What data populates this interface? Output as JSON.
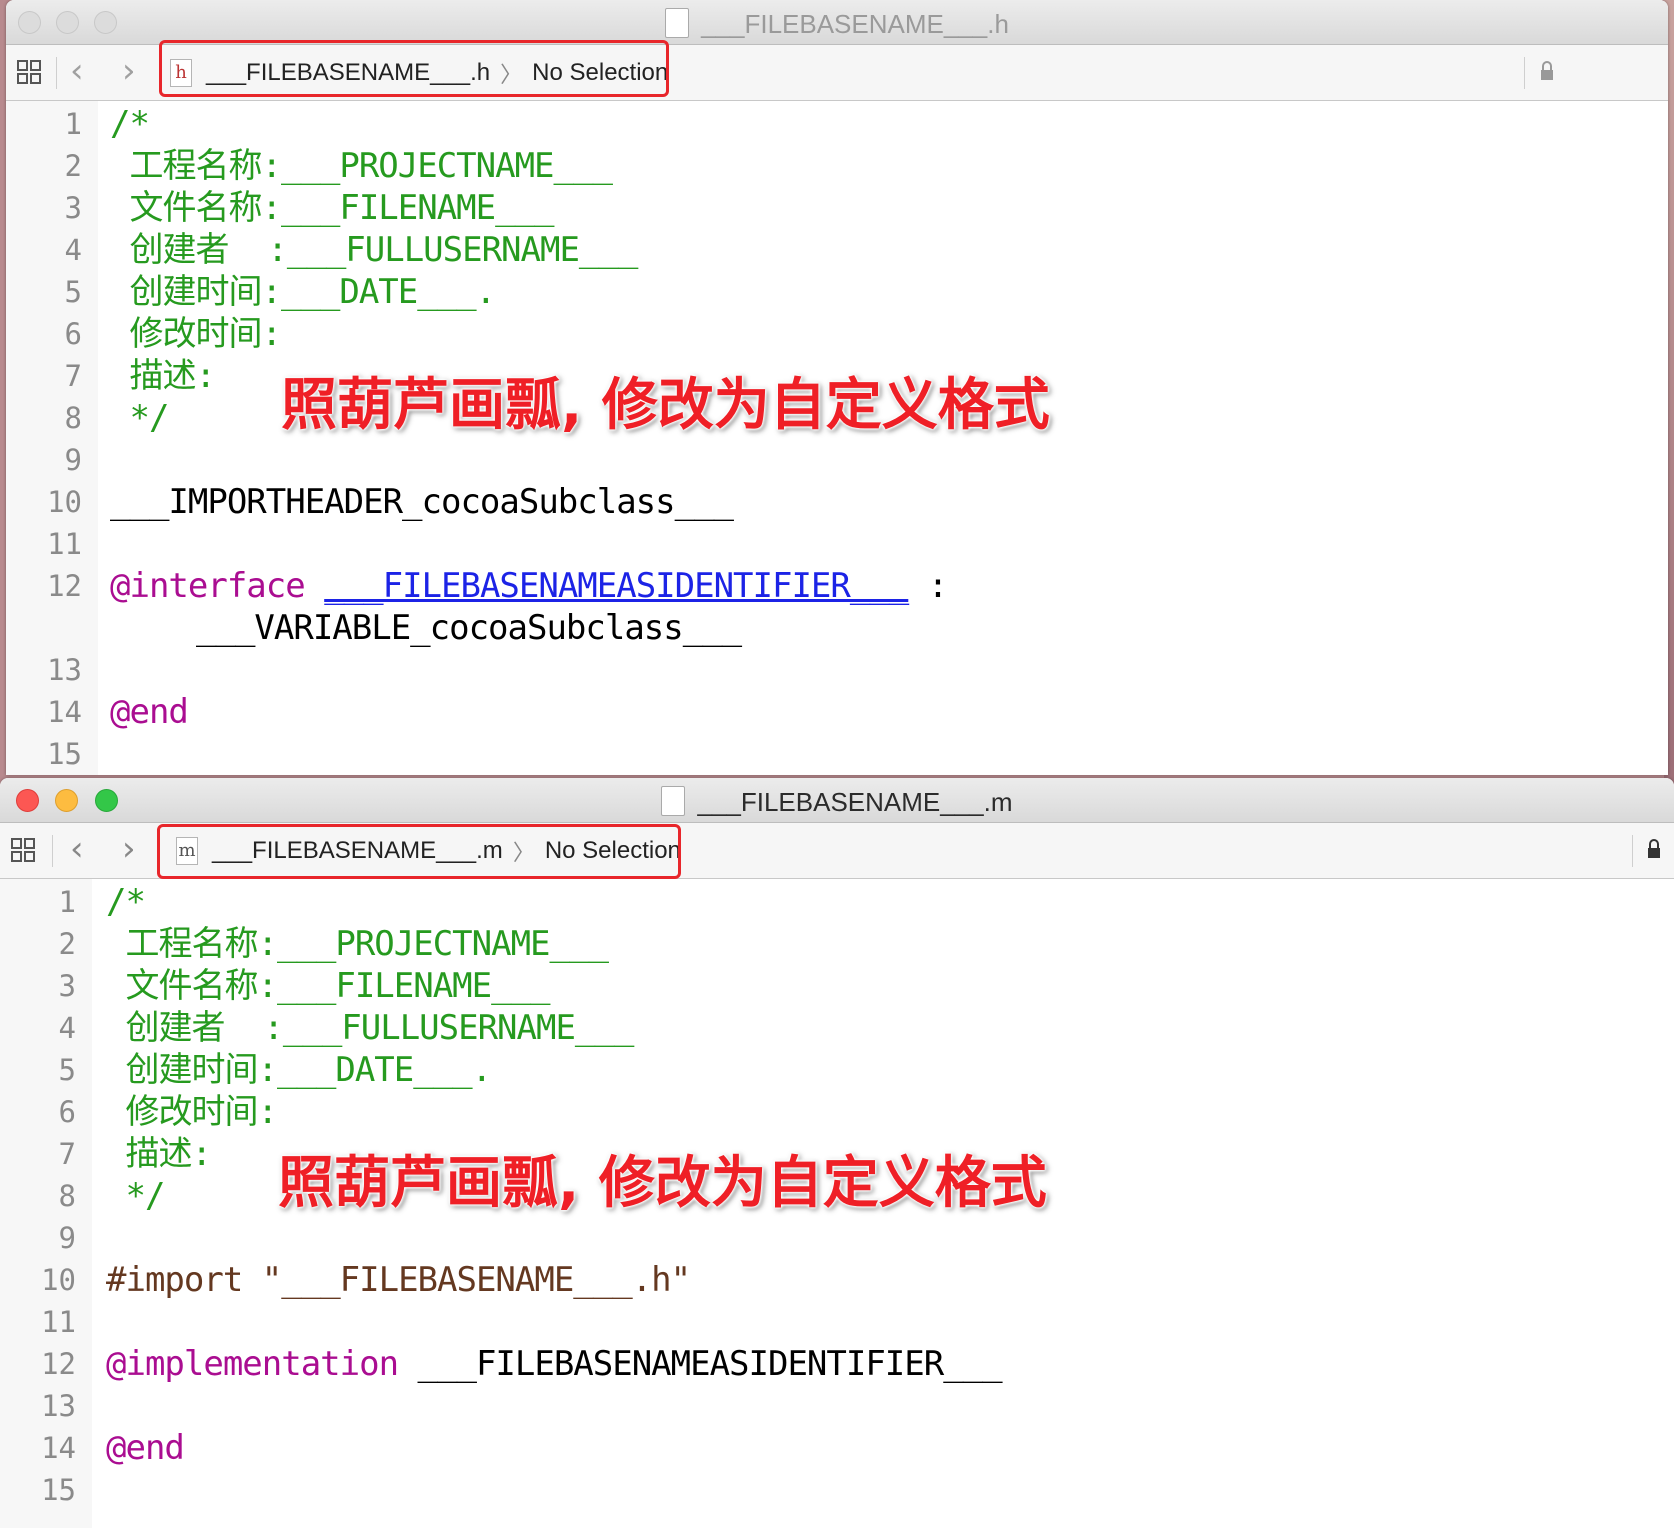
{
  "window_h": {
    "title": "___FILEBASENAME___.h",
    "file_icon_letter": "h",
    "breadcrumb_file": "___FILEBASENAME___.h",
    "breadcrumb_selection": "No Selection",
    "lines": [
      "1",
      "2",
      "3",
      "4",
      "5",
      "6",
      "7",
      "8",
      "9",
      "10",
      "11",
      "12",
      "13",
      "14",
      "15"
    ],
    "comment": {
      "open": "/*",
      "project": " 工程名称:___PROJECTNAME___",
      "file": " 文件名称:___FILENAME___",
      "creator": " 创建者  :___FULLUSERNAME___",
      "created": " 创建时间:___DATE___.",
      "modified": " 修改时间:",
      "desc": " 描述:",
      "close": " */"
    },
    "import_line": "___IMPORTHEADER_cocoaSubclass___",
    "interface_kw": "@interface",
    "interface_name": "___FILEBASENAMEASIDENTIFIER___",
    "interface_colon": " :",
    "superclass": "___VARIABLE_cocoaSubclass___",
    "end_kw": "@end",
    "annotation": "照葫芦画瓢, 修改为自定义格式"
  },
  "window_m": {
    "title": "___FILEBASENAME___.m",
    "file_icon_letter": "m",
    "breadcrumb_file": "___FILEBASENAME___.m",
    "breadcrumb_selection": "No Selection",
    "lines": [
      "1",
      "2",
      "3",
      "4",
      "5",
      "6",
      "7",
      "8",
      "9",
      "10",
      "11",
      "12",
      "13",
      "14",
      "15"
    ],
    "comment": {
      "open": "/*",
      "project": " 工程名称:___PROJECTNAME___",
      "file": " 文件名称:___FILENAME___",
      "creator": " 创建者  :___FULLUSERNAME___",
      "created": " 创建时间:___DATE___.",
      "modified": " 修改时间:",
      "desc": " 描述:",
      "close": " */"
    },
    "import_kw": "#import",
    "import_path": "\"___FILEBASENAME___.h\"",
    "impl_kw": "@implementation",
    "impl_name": "___FILEBASENAMEASIDENTIFIER___",
    "end_kw": "@end",
    "annotation": "照葫芦画瓢, 修改为自定义格式"
  },
  "colors": {
    "comment": "#269a1f",
    "keyword": "#aa0d91",
    "preprocessor": "#643820",
    "link": "#1c23e6",
    "highlight_box": "#e8262b",
    "close": "#fc5753",
    "minimize": "#fdbc40",
    "zoom": "#33c748"
  }
}
